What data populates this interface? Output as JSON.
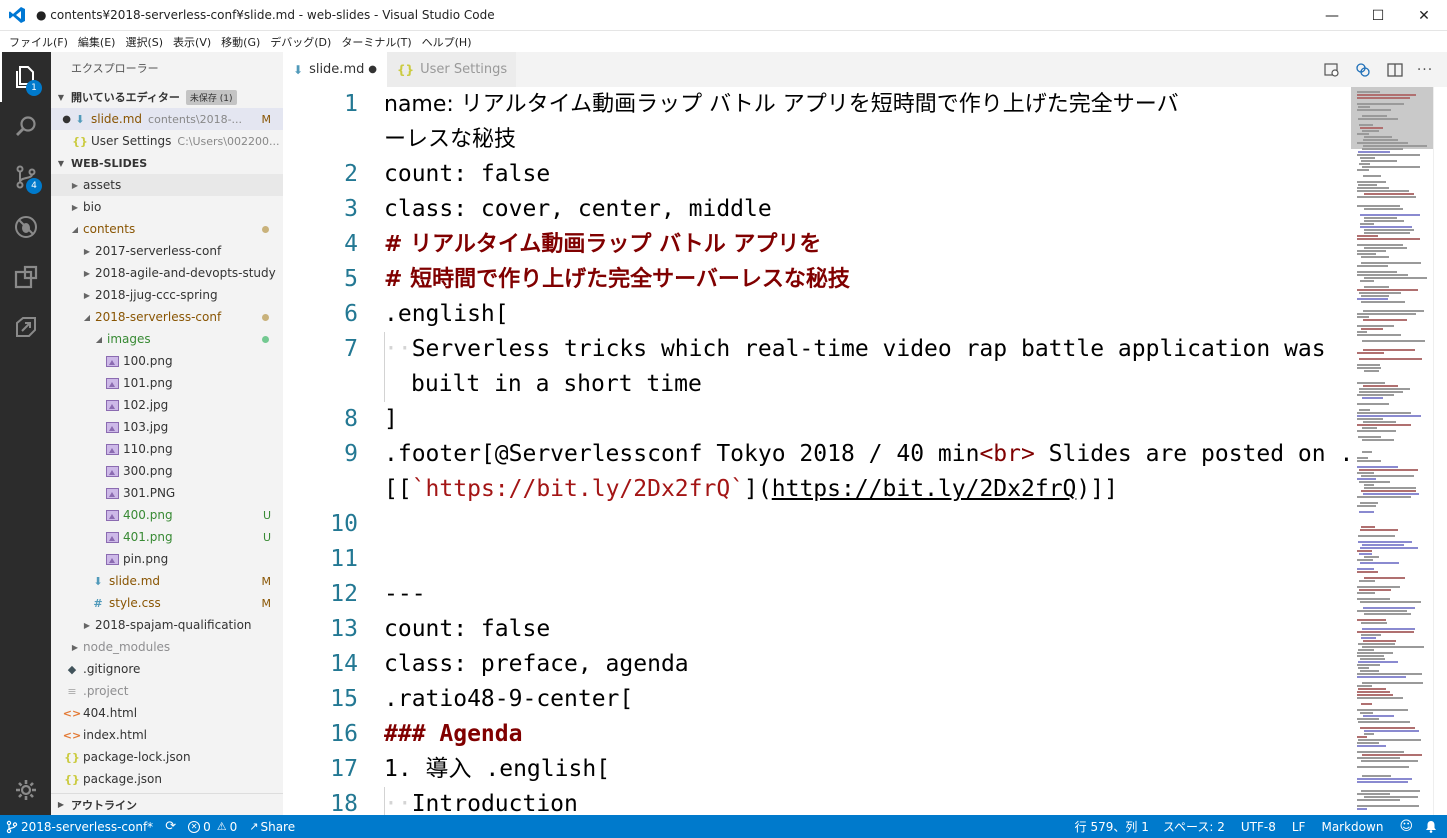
{
  "window": {
    "title": "● contents¥2018-serverless-conf¥slide.md - web-slides - Visual Studio Code",
    "minimize": "—",
    "maximize": "☐",
    "close": "✕"
  },
  "menu": [
    "ファイル(F)",
    "編集(E)",
    "選択(S)",
    "表示(V)",
    "移動(G)",
    "デバッグ(D)",
    "ターミナル(T)",
    "ヘルプ(H)"
  ],
  "activity_bar": {
    "explorer_badge": "1",
    "scm_badge": "4",
    "icons": [
      "files-icon",
      "search-icon",
      "source-control-icon",
      "debug-icon",
      "extensions-icon",
      "remote-icon",
      "gear-icon"
    ]
  },
  "sidebar": {
    "title": "エクスプローラー",
    "open_editors": {
      "header": "開いているエディター",
      "badge": "未保存 (1)",
      "items": [
        {
          "name": "slide.md",
          "desc": "contents\\2018-...",
          "deco": "M",
          "dirty": "●"
        },
        {
          "name": "User Settings",
          "desc": "C:\\Users\\002200..."
        }
      ]
    },
    "workspace": {
      "header": "WEB-SLIDES",
      "items": [
        {
          "name": "assets"
        },
        {
          "name": "bio"
        },
        {
          "name": "contents"
        },
        {
          "name": "2017-serverless-conf"
        },
        {
          "name": "2018-agile-and-devopts-study"
        },
        {
          "name": "2018-jjug-ccc-spring"
        },
        {
          "name": "2018-serverless-conf"
        },
        {
          "name": "images"
        },
        {
          "name": "100.png"
        },
        {
          "name": "101.png"
        },
        {
          "name": "102.jpg"
        },
        {
          "name": "103.jpg"
        },
        {
          "name": "110.png"
        },
        {
          "name": "300.png"
        },
        {
          "name": "301.PNG"
        },
        {
          "name": "400.png",
          "deco": "U"
        },
        {
          "name": "401.png",
          "deco": "U"
        },
        {
          "name": "pin.png"
        },
        {
          "name": "slide.md",
          "deco": "M"
        },
        {
          "name": "style.css",
          "deco": "M"
        },
        {
          "name": "2018-spajam-qualification"
        },
        {
          "name": "node_modules"
        },
        {
          "name": ".gitignore"
        },
        {
          "name": ".project"
        },
        {
          "name": "404.html"
        },
        {
          "name": "index.html"
        },
        {
          "name": "package-lock.json"
        },
        {
          "name": "package.json"
        }
      ]
    },
    "outline_header": "アウトライン"
  },
  "tabs": [
    {
      "label": "slide.md",
      "dirty": "●"
    },
    {
      "label": "User Settings"
    }
  ],
  "editor": {
    "line_numbers": [
      "1",
      "",
      "2",
      "3",
      "4",
      "5",
      "6",
      "7",
      "",
      "8",
      "9",
      "",
      "10",
      "11",
      "12",
      "13",
      "14",
      "15",
      "16",
      "17",
      "18"
    ],
    "text": {
      "l1a": "name: リアルタイム動画ラップ バトル アプリを短時間で作り上げた完全サーバ",
      "l1b": "ーレスな秘技",
      "l2": "count: false",
      "l3": "class: cover, center, middle",
      "l4": "# リアルタイム動画ラップ バトル アプリを",
      "l5": "# 短時間で作り上げた完全サーバーレスな秘技",
      "l6": ".english[",
      "l7ws": "··",
      "l7a": "Serverless tricks which real-time video rap battle application was",
      "l7b": "built in a short time",
      "l8": "]",
      "l9a_1": ".footer[@Serverlessconf Tokyo 2018 / 40 min",
      "l9a_tag": "<br>",
      "l9a_2": " Slides are posted on .url",
      "l9b_1": "[[",
      "l9b_str": "`https://bit.ly/2Dx2frQ`",
      "l9b_2": "](",
      "l9b_link": "https://bit.ly/2Dx2frQ",
      "l9b_3": ")]]",
      "l12": "---",
      "l13": "count: false",
      "l14": "class: preface, agenda",
      "l15": ".ratio48-9-center[",
      "l16": "### Agenda",
      "l17": "1. 導入 .english[",
      "l18ws": "··",
      "l18": "Introduction"
    }
  },
  "status": {
    "branch": "2018-serverless-conf*",
    "errors": "0",
    "warnings": "0",
    "share": "Share",
    "position": "行 579、列 1",
    "spaces": "スペース: 2",
    "encoding": "UTF-8",
    "eol": "LF",
    "language": "Markdown"
  },
  "colors": {
    "accent": "#007acc",
    "activity_bar": "#2c2c2c",
    "heading": "#800000",
    "line_number": "#237893",
    "git_modified": "#895503",
    "git_untracked": "#388a34"
  }
}
